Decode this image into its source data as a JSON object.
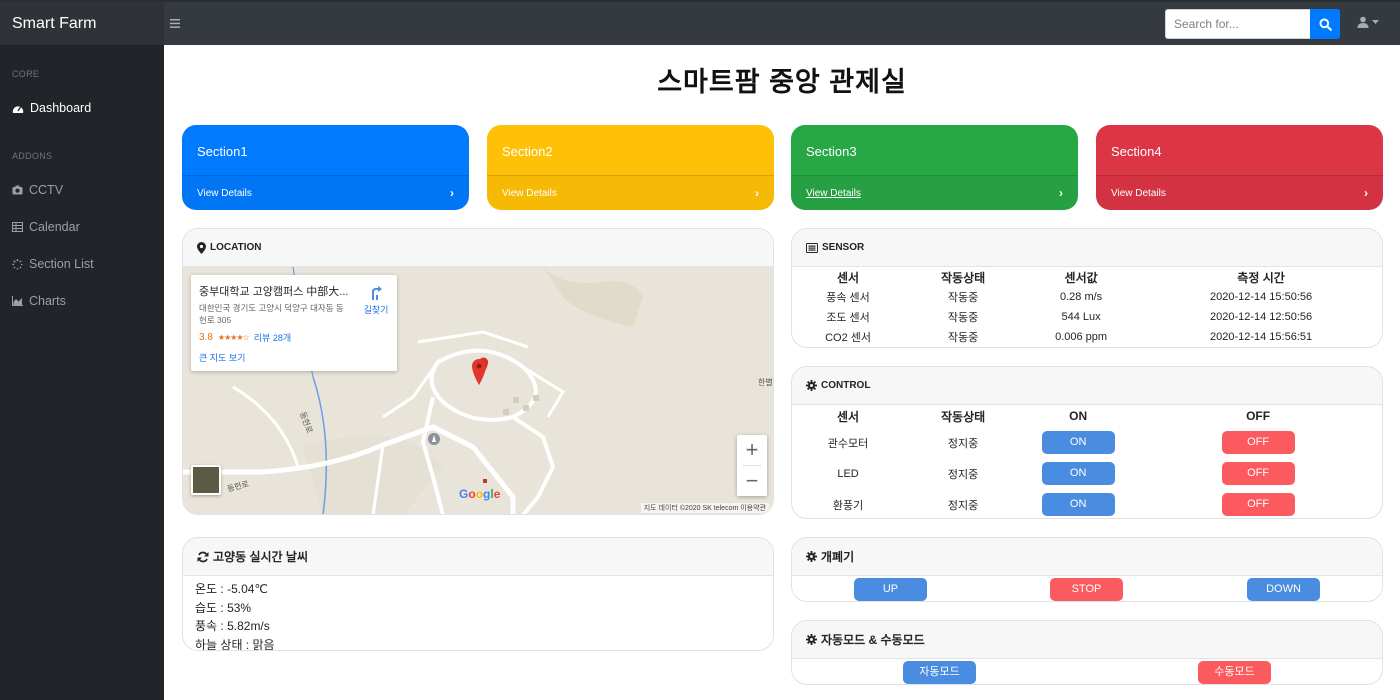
{
  "navbar": {
    "brand": "Smart Farm",
    "search_placeholder": "Search for..."
  },
  "sidebar": {
    "core_heading": "CORE",
    "addons_heading": "ADDONS",
    "items": [
      {
        "label": "Dashboard",
        "icon": "tachometer-icon",
        "active": true
      },
      {
        "label": "CCTV",
        "icon": "camera-icon"
      },
      {
        "label": "Calendar",
        "icon": "table-icon"
      },
      {
        "label": "Section List",
        "icon": "spinner-icon"
      },
      {
        "label": "Charts",
        "icon": "area-chart-icon"
      }
    ]
  },
  "page_title": "스마트팜 중앙 관제실",
  "sections": [
    {
      "title": "Section1",
      "link": "View Details",
      "color": "#007bff"
    },
    {
      "title": "Section2",
      "link": "View Details",
      "color": "#ffc107"
    },
    {
      "title": "Section3",
      "link": "View Details",
      "color": "#28a745"
    },
    {
      "title": "Section4",
      "link": "View Details",
      "color": "#dc3545"
    }
  ],
  "location": {
    "header": "LOCATION",
    "place_name": "중부대학교 고양캠퍼스 中部大...",
    "address": "대한민국 경기도 고양시 덕양구 대자동 동헌로 305",
    "rating": "3.8",
    "reviews": "리뷰 28개",
    "big_map": "큰 지도 보기",
    "directions": "길찾기",
    "attribution": "지도 데이터 ©2020 SK telecom   이용약관",
    "google": "Google",
    "road_label_1": "동헌로",
    "road_label_2": "동헌로",
    "road_label_3": "한별"
  },
  "sensor": {
    "header": "SENSOR",
    "columns": [
      "센서",
      "작동상태",
      "센서값",
      "측정 시간"
    ],
    "rows": [
      [
        "풍속 센서",
        "작동중",
        "0.28 m/s",
        "2020-12-14 15:50:56"
      ],
      [
        "조도 센서",
        "작동중",
        "544 Lux",
        "2020-12-14 12:50:56"
      ],
      [
        "CO2 센서",
        "작동중",
        "0.006 ppm",
        "2020-12-14 15:56:51"
      ]
    ]
  },
  "control": {
    "header": "CONTROL",
    "columns": [
      "센서",
      "작동상태",
      "ON",
      "OFF"
    ],
    "rows": [
      {
        "name": "관수모터",
        "status": "정지중",
        "on": "ON",
        "off": "OFF"
      },
      {
        "name": "LED",
        "status": "정지중",
        "on": "ON",
        "off": "OFF"
      },
      {
        "name": "환풍기",
        "status": "정지중",
        "on": "ON",
        "off": "OFF"
      }
    ]
  },
  "weather": {
    "header": "고양동 실시간 날씨",
    "lines": [
      "온도 : -5.04℃",
      "습도 : 53%",
      "풍속 : 5.82m/s",
      "하늘 상태 : 맑음"
    ]
  },
  "opener": {
    "header": "개폐기",
    "up": "UP",
    "stop": "STOP",
    "down": "DOWN"
  },
  "mode": {
    "header": "자동모드 & 수동모드",
    "auto": "자동모드",
    "manual": "수동모드"
  }
}
